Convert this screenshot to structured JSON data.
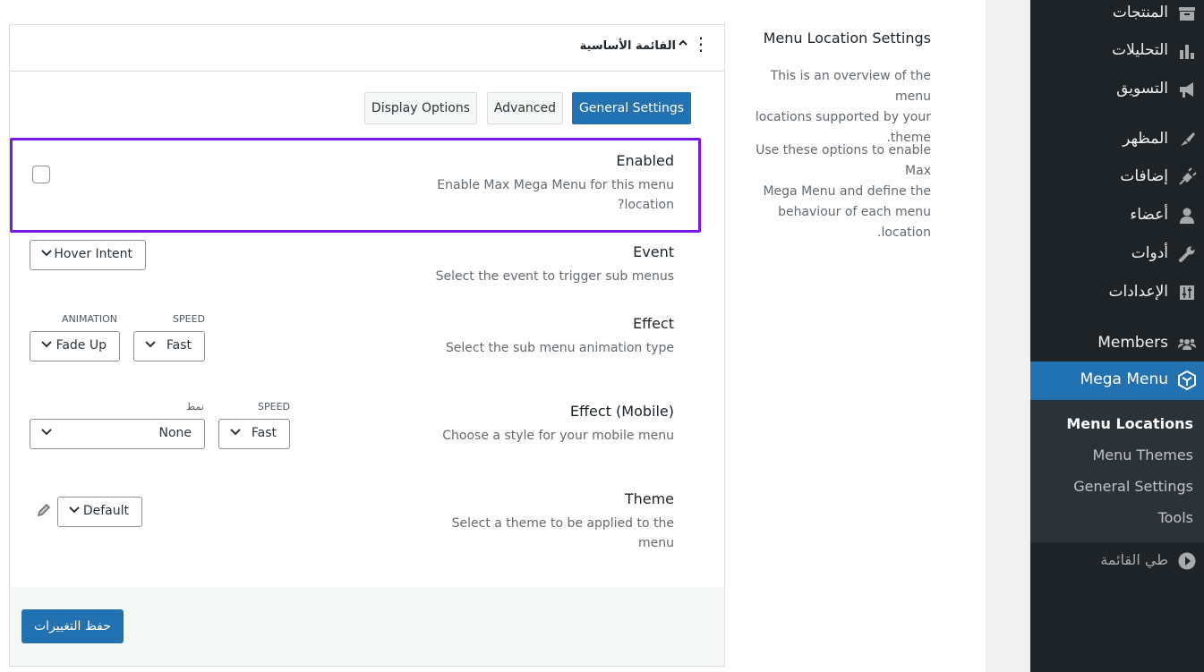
{
  "panel": {
    "title": "القائمة الأساسية",
    "tabs": [
      {
        "label": "General Settings",
        "active": true
      },
      {
        "label": "Advanced",
        "active": false
      },
      {
        "label": "Display Options",
        "active": false
      }
    ],
    "enabled": {
      "label": "Enabled",
      "desc_line1": "Enable Max Mega Menu for this menu",
      "desc_line2": "location?",
      "checked": false
    },
    "event": {
      "label": "Event",
      "desc": "Select the event to trigger sub menus",
      "value": "Hover Intent"
    },
    "effect": {
      "label": "Effect",
      "desc": "Select the sub menu animation type",
      "animation_caption": "ANIMATION",
      "speed_caption": "SPEED",
      "animation_value": "Fade Up",
      "speed_value": "Fast"
    },
    "effect_mobile": {
      "label": "Effect (Mobile)",
      "desc": "Choose a style for your mobile menu",
      "style_caption": "نمط",
      "speed_caption": "SPEED",
      "style_value": "None",
      "speed_value": "Fast"
    },
    "theme": {
      "label": "Theme",
      "desc_line1": "Select a theme to be applied to the",
      "desc_line2": "menu",
      "value": "Default"
    },
    "save_label": "حفظ التغييرات"
  },
  "info": {
    "title": "Menu Location Settings",
    "p1_lines": [
      "This is an overview of the menu",
      "locations supported by your",
      "theme."
    ],
    "p2_lines": [
      "Use these options to enable Max",
      "Mega Menu and define the",
      "behaviour of each menu location."
    ]
  },
  "sidebar": {
    "items": [
      {
        "label": "المنتجات",
        "icon": "archive-icon"
      },
      {
        "label": "التحليلات",
        "icon": "bar-chart-icon"
      },
      {
        "label": "التسويق",
        "icon": "megaphone-icon"
      },
      {
        "label": "المظهر",
        "icon": "paintbrush-icon"
      },
      {
        "label": "إضافات",
        "icon": "plugin-icon"
      },
      {
        "label": "أعضاء",
        "icon": "user-icon"
      },
      {
        "label": "أدوات",
        "icon": "wrench-icon"
      },
      {
        "label": "الإعدادات",
        "icon": "settings-sliders-icon"
      },
      {
        "label": "Members",
        "icon": "groups-icon"
      },
      {
        "label": "Mega Menu",
        "icon": "mega-menu-icon"
      },
      {
        "label": "طي القائمة",
        "icon": "collapse-icon"
      }
    ],
    "submenu": [
      "Menu Locations",
      "Menu Themes",
      "General Settings",
      "Tools"
    ],
    "accent": "#2271b1"
  }
}
